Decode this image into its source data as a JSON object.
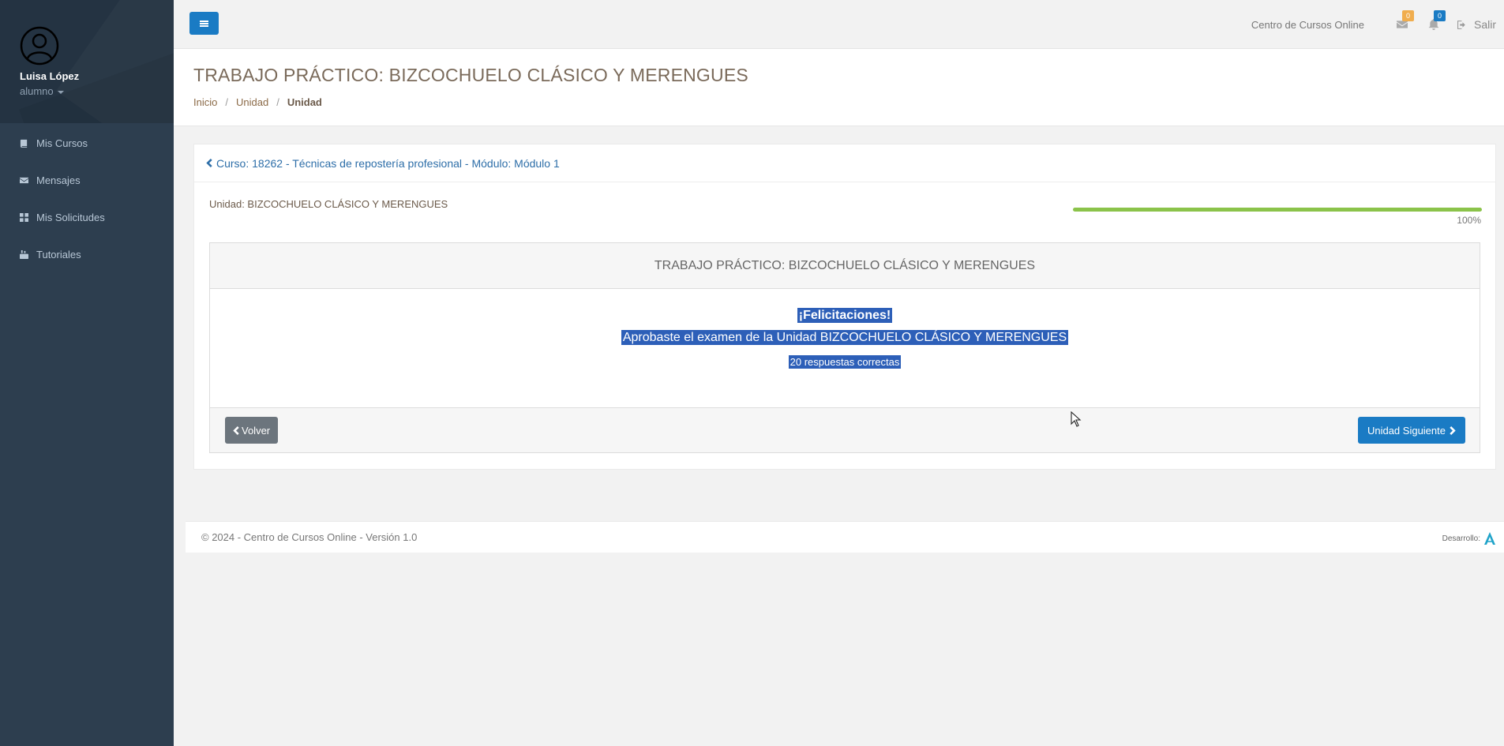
{
  "sidebar": {
    "user_name": "Luisa López",
    "user_role": "alumno",
    "items": [
      {
        "label": "Mis Cursos",
        "icon": "book-icon"
      },
      {
        "label": "Mensajes",
        "icon": "envelope-icon"
      },
      {
        "label": "Mis Solicitudes",
        "icon": "grid-icon"
      },
      {
        "label": "Tutoriales",
        "icon": "youtube-icon"
      }
    ]
  },
  "topbar": {
    "site_name": "Centro de Cursos Online",
    "messages_count": "0",
    "notifications_count": "0",
    "logout_label": "Salir"
  },
  "header": {
    "title": "TRABAJO PRÁCTICO: BIZCOCHUELO CLÁSICO Y MERENGUES",
    "breadcrumb": [
      "Inicio",
      "Unidad",
      "Unidad"
    ]
  },
  "main": {
    "course_link": "Curso: 18262 - Técnicas de repostería profesional - Módulo: Módulo 1",
    "unit_label": "Unidad: BIZCOCHUELO CLÁSICO Y MERENGUES",
    "progress_value": 100,
    "progress_text": "100%",
    "exam_title": "TRABAJO PRÁCTICO: BIZCOCHUELO CLÁSICO Y MERENGUES",
    "congrats": "¡Felicitaciones!",
    "congrats_message": "Aprobaste el examen de la Unidad BIZCOCHUELO CLÁSICO Y MERENGUES",
    "answers_text": "20 respuestas correctas",
    "back_label": "Volver",
    "next_label": "Unidad Siguiente"
  },
  "footer": {
    "copyright": "© 2024 - Centro de Cursos Online - Versión 1.0",
    "dev_label": "Desarrollo:"
  },
  "colors": {
    "sidebar_bg": "#2d3e4f",
    "primary": "#1a7bc4",
    "progress": "#8bc34a",
    "selection": "#2d5fb8"
  }
}
